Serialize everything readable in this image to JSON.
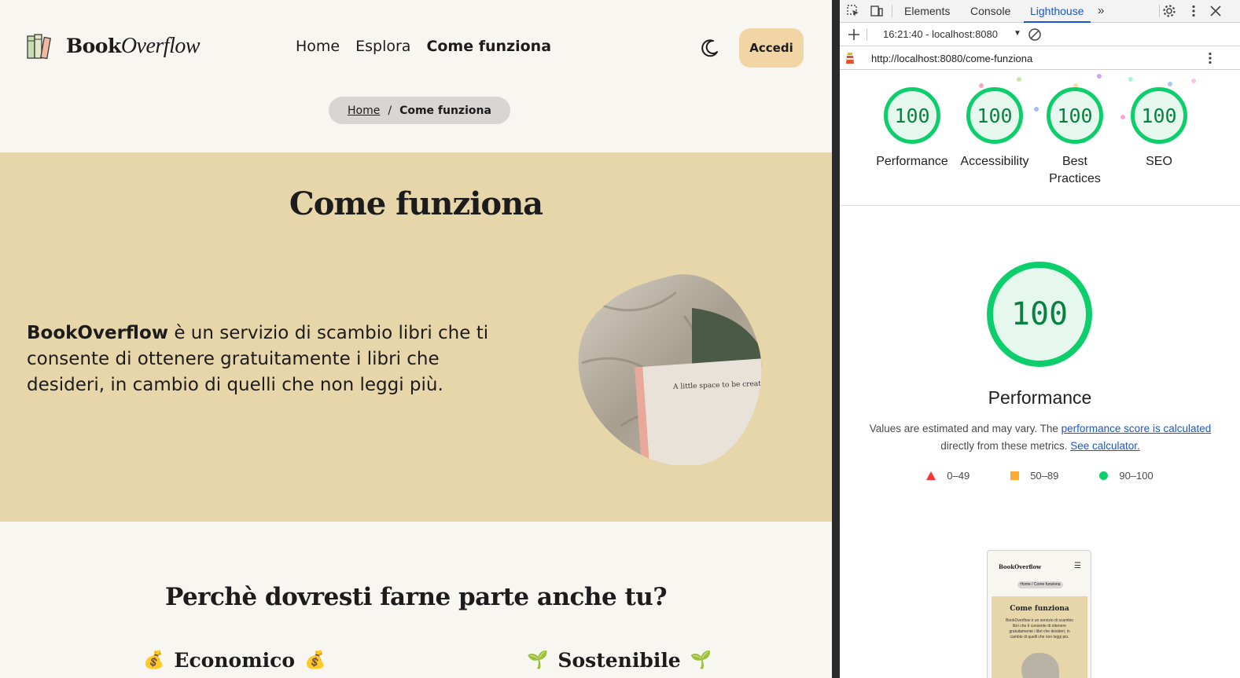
{
  "site": {
    "logo": {
      "brand_bold": "Book",
      "brand_italic": "Overflow"
    },
    "nav": {
      "home": "Home",
      "explore": "Esplora",
      "how_it_works": "Come funziona"
    },
    "login_button": "Accedi",
    "breadcrumb": {
      "home": "Home",
      "separator": "/",
      "current": "Come funziona"
    },
    "hero": {
      "title": "Come funziona",
      "text_bold": "BookOverflow",
      "text_rest": " è un servizio di scambio libri che ti consente di ottenere gratuitamente i libri che desideri, in cambio di quelli che non leggi più.",
      "image_caption": "A little space to be creative"
    },
    "section_title": "Perchè dovresti farne parte anche tu?",
    "features": [
      {
        "emoji": "💰",
        "label": "Economico"
      },
      {
        "emoji": "🌱",
        "label": "Sostenibile"
      }
    ],
    "colors": {
      "hero_bg": "#e8d6ab",
      "page_bg": "#f7f6f1",
      "button_bg": "#f1d5a4"
    }
  },
  "devtools": {
    "tabs": [
      "Elements",
      "Console",
      "Lighthouse"
    ],
    "active_tab": "Lighthouse",
    "run_label": "16:21:40 - localhost:8080",
    "url": "http://localhost:8080/come-funziona",
    "scores": [
      {
        "label": "Performance",
        "score": "100"
      },
      {
        "label": "Accessibility",
        "score": "100"
      },
      {
        "label": "Best Practices",
        "score": "100"
      },
      {
        "label": "SEO",
        "score": "100"
      }
    ],
    "main_gauge": {
      "score": "100",
      "title": "Performance"
    },
    "description": {
      "prefix": "Values are estimated and may vary. The ",
      "link1": "performance score is calculated",
      "middle": " directly from these metrics. ",
      "link2": "See calculator."
    },
    "legend": [
      {
        "shape": "triangle",
        "range": "0–49",
        "color": "#ff3333"
      },
      {
        "shape": "square",
        "range": "50–89",
        "color": "#ffaa33"
      },
      {
        "shape": "circle",
        "range": "90–100",
        "color": "#0cce6b"
      }
    ],
    "thumbnail": {
      "brand": "BookOverflow",
      "breadcrumb": "Home / Come funziona",
      "title": "Come funziona",
      "text": "BookOverflow è un servizio di scambio libri che ti consente di ottenere gratuitamente i libri che desideri, in cambio di quelli che non leggi più."
    },
    "colors": {
      "pass_green": "#0cce6b",
      "active_tab": "#1a55d2"
    }
  }
}
